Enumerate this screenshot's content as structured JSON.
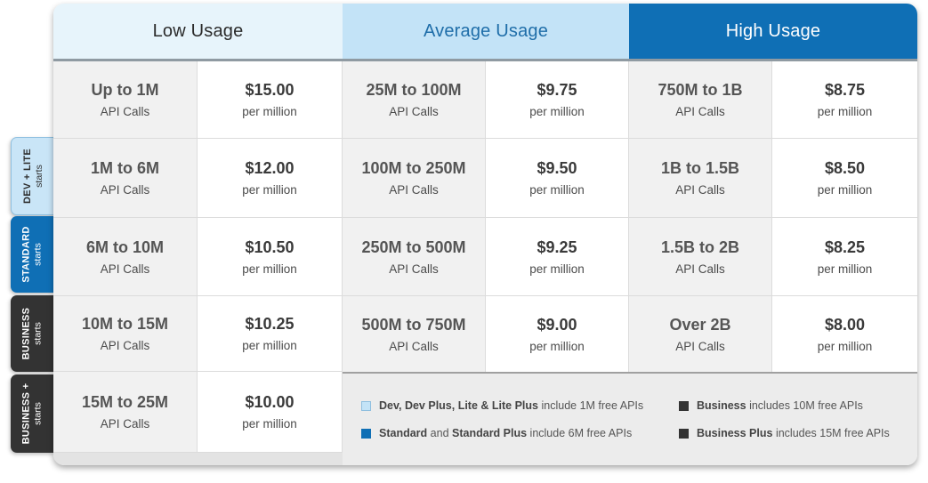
{
  "headers": {
    "low": "Low Usage",
    "average": "Average Usage",
    "high": "High Usage"
  },
  "rows": [
    {
      "low": {
        "range": "Up to 1M",
        "range_unit": "API Calls",
        "price": "$15.00",
        "price_unit": "per million"
      },
      "average": {
        "range": "25M to 100M",
        "range_unit": "API Calls",
        "price": "$9.75",
        "price_unit": "per million"
      },
      "high": {
        "range": "750M to 1B",
        "range_unit": "API Calls",
        "price": "$8.75",
        "price_unit": "per million"
      }
    },
    {
      "low": {
        "range": "1M to 6M",
        "range_unit": "API Calls",
        "price": "$12.00",
        "price_unit": "per million"
      },
      "average": {
        "range": "100M to 250M",
        "range_unit": "API Calls",
        "price": "$9.50",
        "price_unit": "per million"
      },
      "high": {
        "range": "1B to 1.5B",
        "range_unit": "API Calls",
        "price": "$8.50",
        "price_unit": "per million"
      }
    },
    {
      "low": {
        "range": "6M to 10M",
        "range_unit": "API Calls",
        "price": "$10.50",
        "price_unit": "per million"
      },
      "average": {
        "range": "250M to 500M",
        "range_unit": "API Calls",
        "price": "$9.25",
        "price_unit": "per million"
      },
      "high": {
        "range": "1.5B to 2B",
        "range_unit": "API Calls",
        "price": "$8.25",
        "price_unit": "per million"
      }
    },
    {
      "low": {
        "range": "10M to 15M",
        "range_unit": "API Calls",
        "price": "$10.25",
        "price_unit": "per million"
      },
      "average": {
        "range": "500M to 750M",
        "range_unit": "API Calls",
        "price": "$9.00",
        "price_unit": "per million"
      },
      "high": {
        "range": "Over 2B",
        "range_unit": "API Calls",
        "price": "$8.00",
        "price_unit": "per million"
      }
    },
    {
      "low": {
        "range": "15M to 25M",
        "range_unit": "API Calls",
        "price": "$10.00",
        "price_unit": "per million"
      }
    }
  ],
  "plan_tabs": [
    {
      "name": "DEV + LITE",
      "label": "starts"
    },
    {
      "name": "STANDARD",
      "label": "starts"
    },
    {
      "name": "BUSINESS",
      "label": "starts"
    },
    {
      "name": "BUSINESS +",
      "label": "starts"
    }
  ],
  "legend": {
    "item1": {
      "bold1": "Dev, Dev Plus, Lite & Lite Plus",
      "rest": "include 1M free APIs"
    },
    "item2": {
      "bold1": "Standard",
      "mid": "and",
      "bold2": "Standard Plus",
      "rest": "include 6M free APIs"
    },
    "item3": {
      "bold1": "Business",
      "rest": "includes 10M free APIs"
    },
    "item4": {
      "bold1": "Business Plus",
      "rest": "includes 15M free APIs"
    }
  },
  "colors": {
    "brand_blue": "#0f6fb5",
    "light_blue": "#c3e3f7",
    "pale_blue": "#e7f4fb",
    "dark": "#333333"
  }
}
